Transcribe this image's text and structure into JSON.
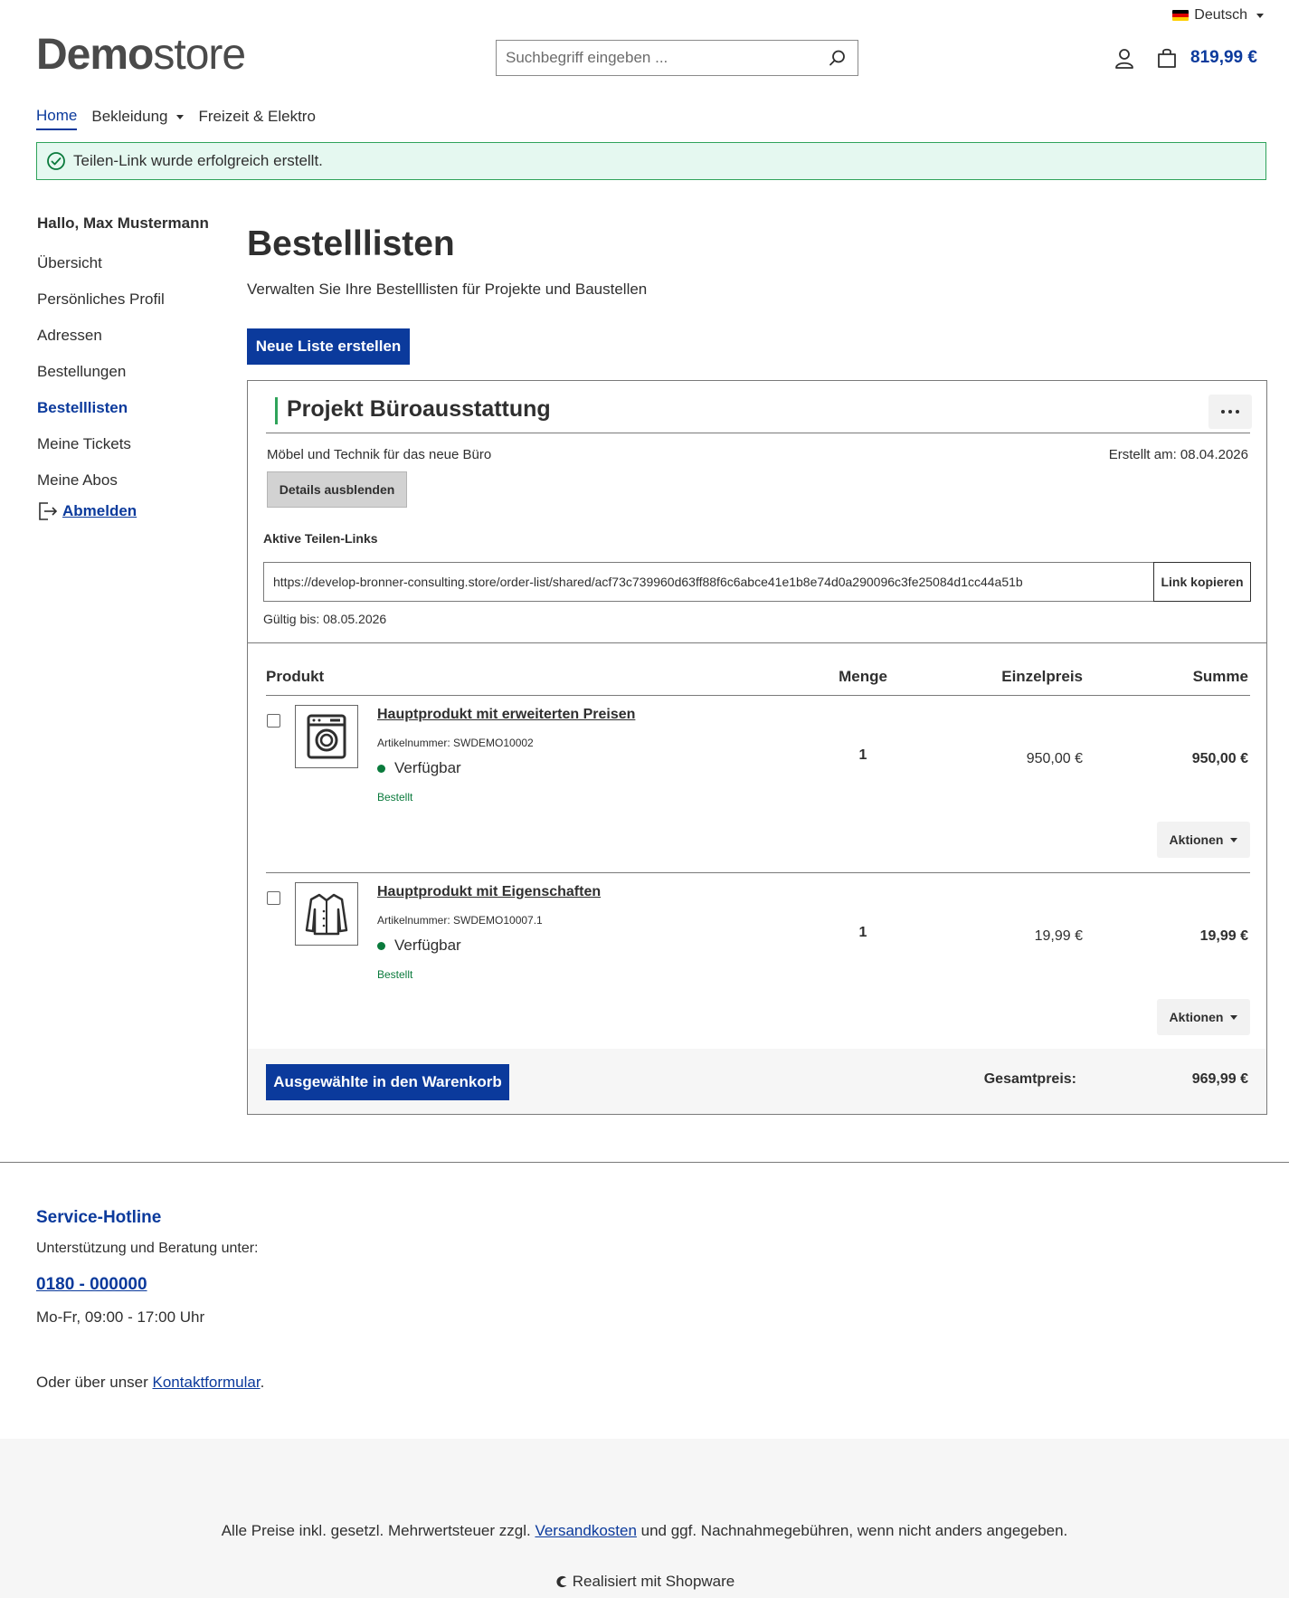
{
  "header": {
    "language": "Deutsch",
    "logo_bold": "Demo",
    "logo_light": "store",
    "search_placeholder": "Suchbegriff eingeben ...",
    "cart_total": "819,99 €"
  },
  "mainnav": {
    "items": [
      {
        "label": "Home"
      },
      {
        "label": "Bekleidung"
      },
      {
        "label": "Freizeit & Elektro"
      }
    ]
  },
  "alert": {
    "message": "Teilen-Link wurde erfolgreich erstellt."
  },
  "sidebar": {
    "greeting": "Hallo, Max Mustermann",
    "items": [
      {
        "label": "Übersicht"
      },
      {
        "label": "Persönliches Profil"
      },
      {
        "label": "Adressen"
      },
      {
        "label": "Bestellungen"
      },
      {
        "label": "Bestelllisten"
      },
      {
        "label": "Meine Tickets"
      },
      {
        "label": "Meine Abos"
      }
    ],
    "logout": "Abmelden"
  },
  "page": {
    "title": "Bestelllisten",
    "subtitle": "Verwalten Sie Ihre Bestelllisten für Projekte und Baustellen",
    "new_list_label": "Neue Liste erstellen"
  },
  "order_list": {
    "title": "Projekt Büroausstattung",
    "description": "Möbel und Technik für das neue Büro",
    "created": "Erstellt am: 08.04.2026",
    "details_toggle": "Details ausblenden",
    "share_heading": "Aktive Teilen-Links",
    "share_url": "https://develop-bronner-consulting.store/order-list/shared/acf73c739960d63ff88f6c6abce41e1b8e74d0a290096c3fe25084d1cc44a51b",
    "copy_label": "Link kopieren",
    "valid_until": "Gültig bis: 08.05.2026",
    "columns": {
      "product": "Produkt",
      "quantity": "Menge",
      "unit_price": "Einzelpreis",
      "total": "Summe"
    },
    "items": [
      {
        "name": "Hauptprodukt mit erweiterten Preisen",
        "sku": "Artikelnummer: SWDEMO10002",
        "availability": "Verfügbar",
        "status": "Bestellt",
        "quantity": "1",
        "unit_price": "950,00 €",
        "total": "950,00 €",
        "actions": "Aktionen",
        "icon": "washing-machine-icon"
      },
      {
        "name": "Hauptprodukt mit Eigenschaften",
        "sku": "Artikelnummer: SWDEMO10007.1",
        "availability": "Verfügbar",
        "status": "Bestellt",
        "quantity": "1",
        "unit_price": "19,99 €",
        "total": "19,99 €",
        "actions": "Aktionen",
        "icon": "jacket-icon"
      }
    ],
    "add_selected_label": "Ausgewählte in den Warenkorb",
    "total_label": "Gesamtpreis:",
    "total_value": "969,99 €"
  },
  "footer": {
    "hotline_title": "Service-Hotline",
    "hotline_sub": "Unterstützung und Beratung unter:",
    "hotline_phone": "0180 - 000000",
    "hotline_hours": "Mo-Fr, 09:00 - 17:00 Uhr",
    "contact_prefix": "Oder über unser ",
    "contact_link": "Kontaktformular",
    "contact_suffix": ".",
    "vat_prefix": "Alle Preise inkl. gesetzl. Mehrwertsteuer zzgl. ",
    "vat_link": "Versandkosten",
    "vat_suffix": " und ggf. Nachnahmegebühren, wenn nicht anders angegeben.",
    "powered": "Realisiert mit Shopware"
  },
  "colors": {
    "brand": "#0b3a9c",
    "success_bg": "#e5f8f0",
    "success_border": "#2fa35a",
    "available": "#0a7a3c"
  }
}
